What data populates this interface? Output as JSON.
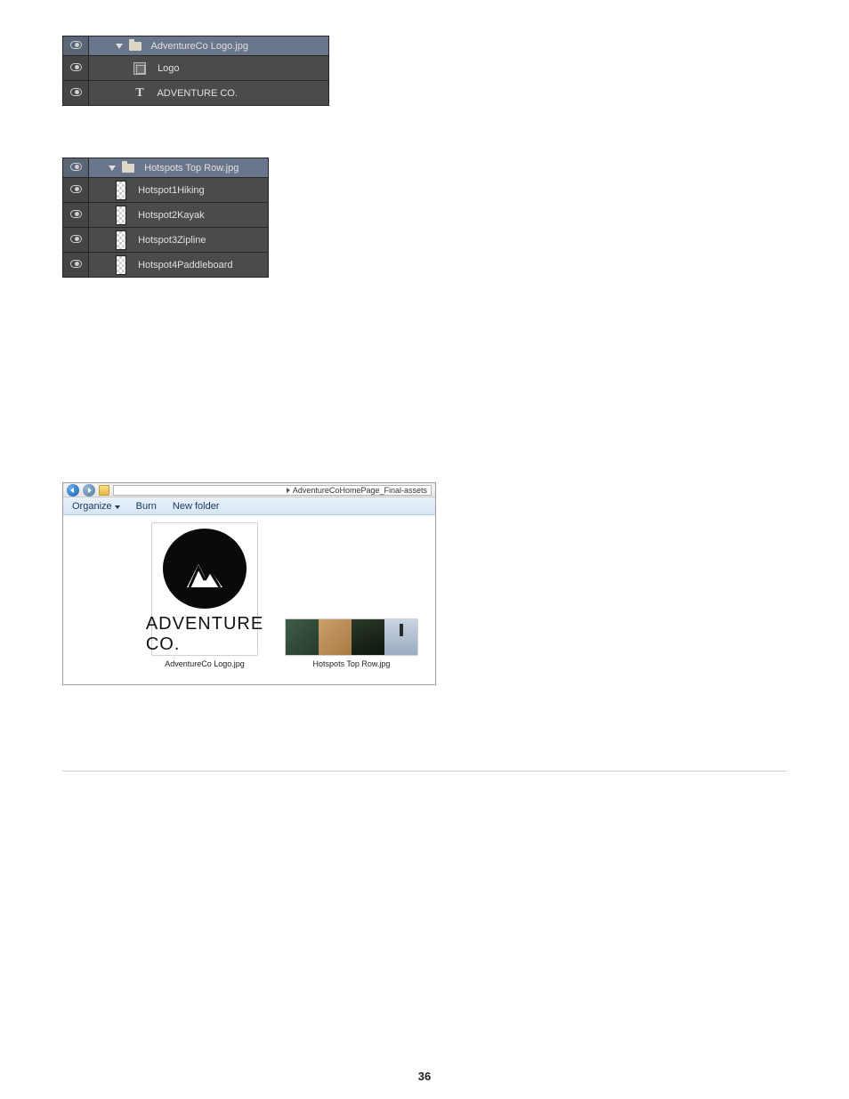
{
  "panel1": {
    "header": "AdventureCo Logo.jpg",
    "layers": [
      {
        "type": "smartobj",
        "name": "Logo"
      },
      {
        "type": "text",
        "name": "ADVENTURE CO."
      }
    ]
  },
  "panel2": {
    "header": "Hotspots Top Row.jpg",
    "layers": [
      {
        "name": "Hotspot1Hiking"
      },
      {
        "name": "Hotspot2Kayak"
      },
      {
        "name": "Hotspot3Zipline"
      },
      {
        "name": "Hotspot4Paddleboard"
      }
    ]
  },
  "explorer": {
    "breadcrumb": "AdventureCoHomePage_Final-assets",
    "toolbar": {
      "organize": "Organize",
      "burn": "Burn",
      "new_folder": "New folder"
    },
    "files": {
      "logo": {
        "caption": "AdventureCo Logo.jpg",
        "logo_text": "ADVENTURE CO."
      },
      "hotspots": {
        "caption": "Hotspots Top Row.jpg"
      }
    }
  },
  "page_number": "36"
}
